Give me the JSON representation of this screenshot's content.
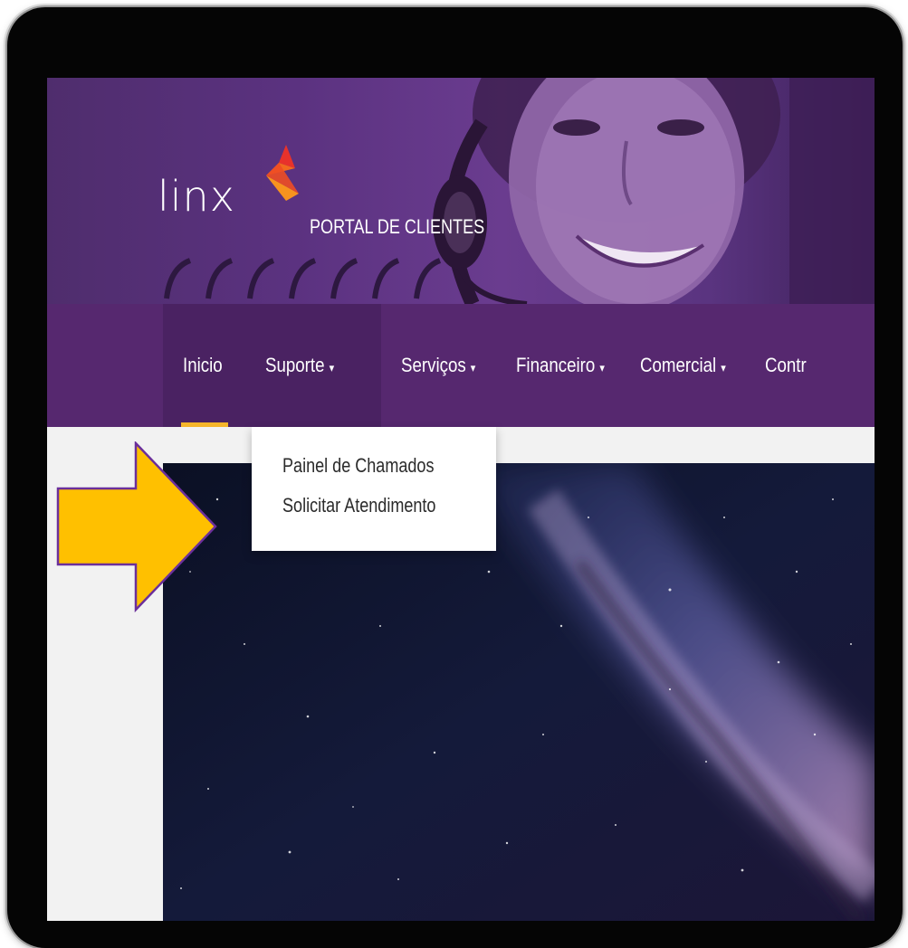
{
  "header": {
    "logo_text": "linx",
    "portal_title": "PORTAL DE CLIENTES"
  },
  "nav": {
    "items": [
      {
        "label": "Inicio",
        "has_caret": false,
        "active": true
      },
      {
        "label": "Suporte",
        "has_caret": true,
        "open": true
      },
      {
        "label": "Serviços",
        "has_caret": true
      },
      {
        "label": "Financeiro",
        "has_caret": true
      },
      {
        "label": "Comercial",
        "has_caret": true
      },
      {
        "label": "Contr",
        "has_caret": false
      }
    ],
    "caret_glyph": "▾"
  },
  "dropdown": {
    "items": [
      {
        "label": "Painel de Chamados"
      },
      {
        "label": "Solicitar Atendimento"
      }
    ]
  },
  "colors": {
    "nav_bg": "#56286f",
    "accent_underline": "#f5b52a",
    "arrow_fill": "#ffc000",
    "arrow_stroke": "#6b2f9b"
  },
  "icons": {
    "logo": "linx-flame-logo",
    "annotation": "yellow-arrow-right"
  }
}
